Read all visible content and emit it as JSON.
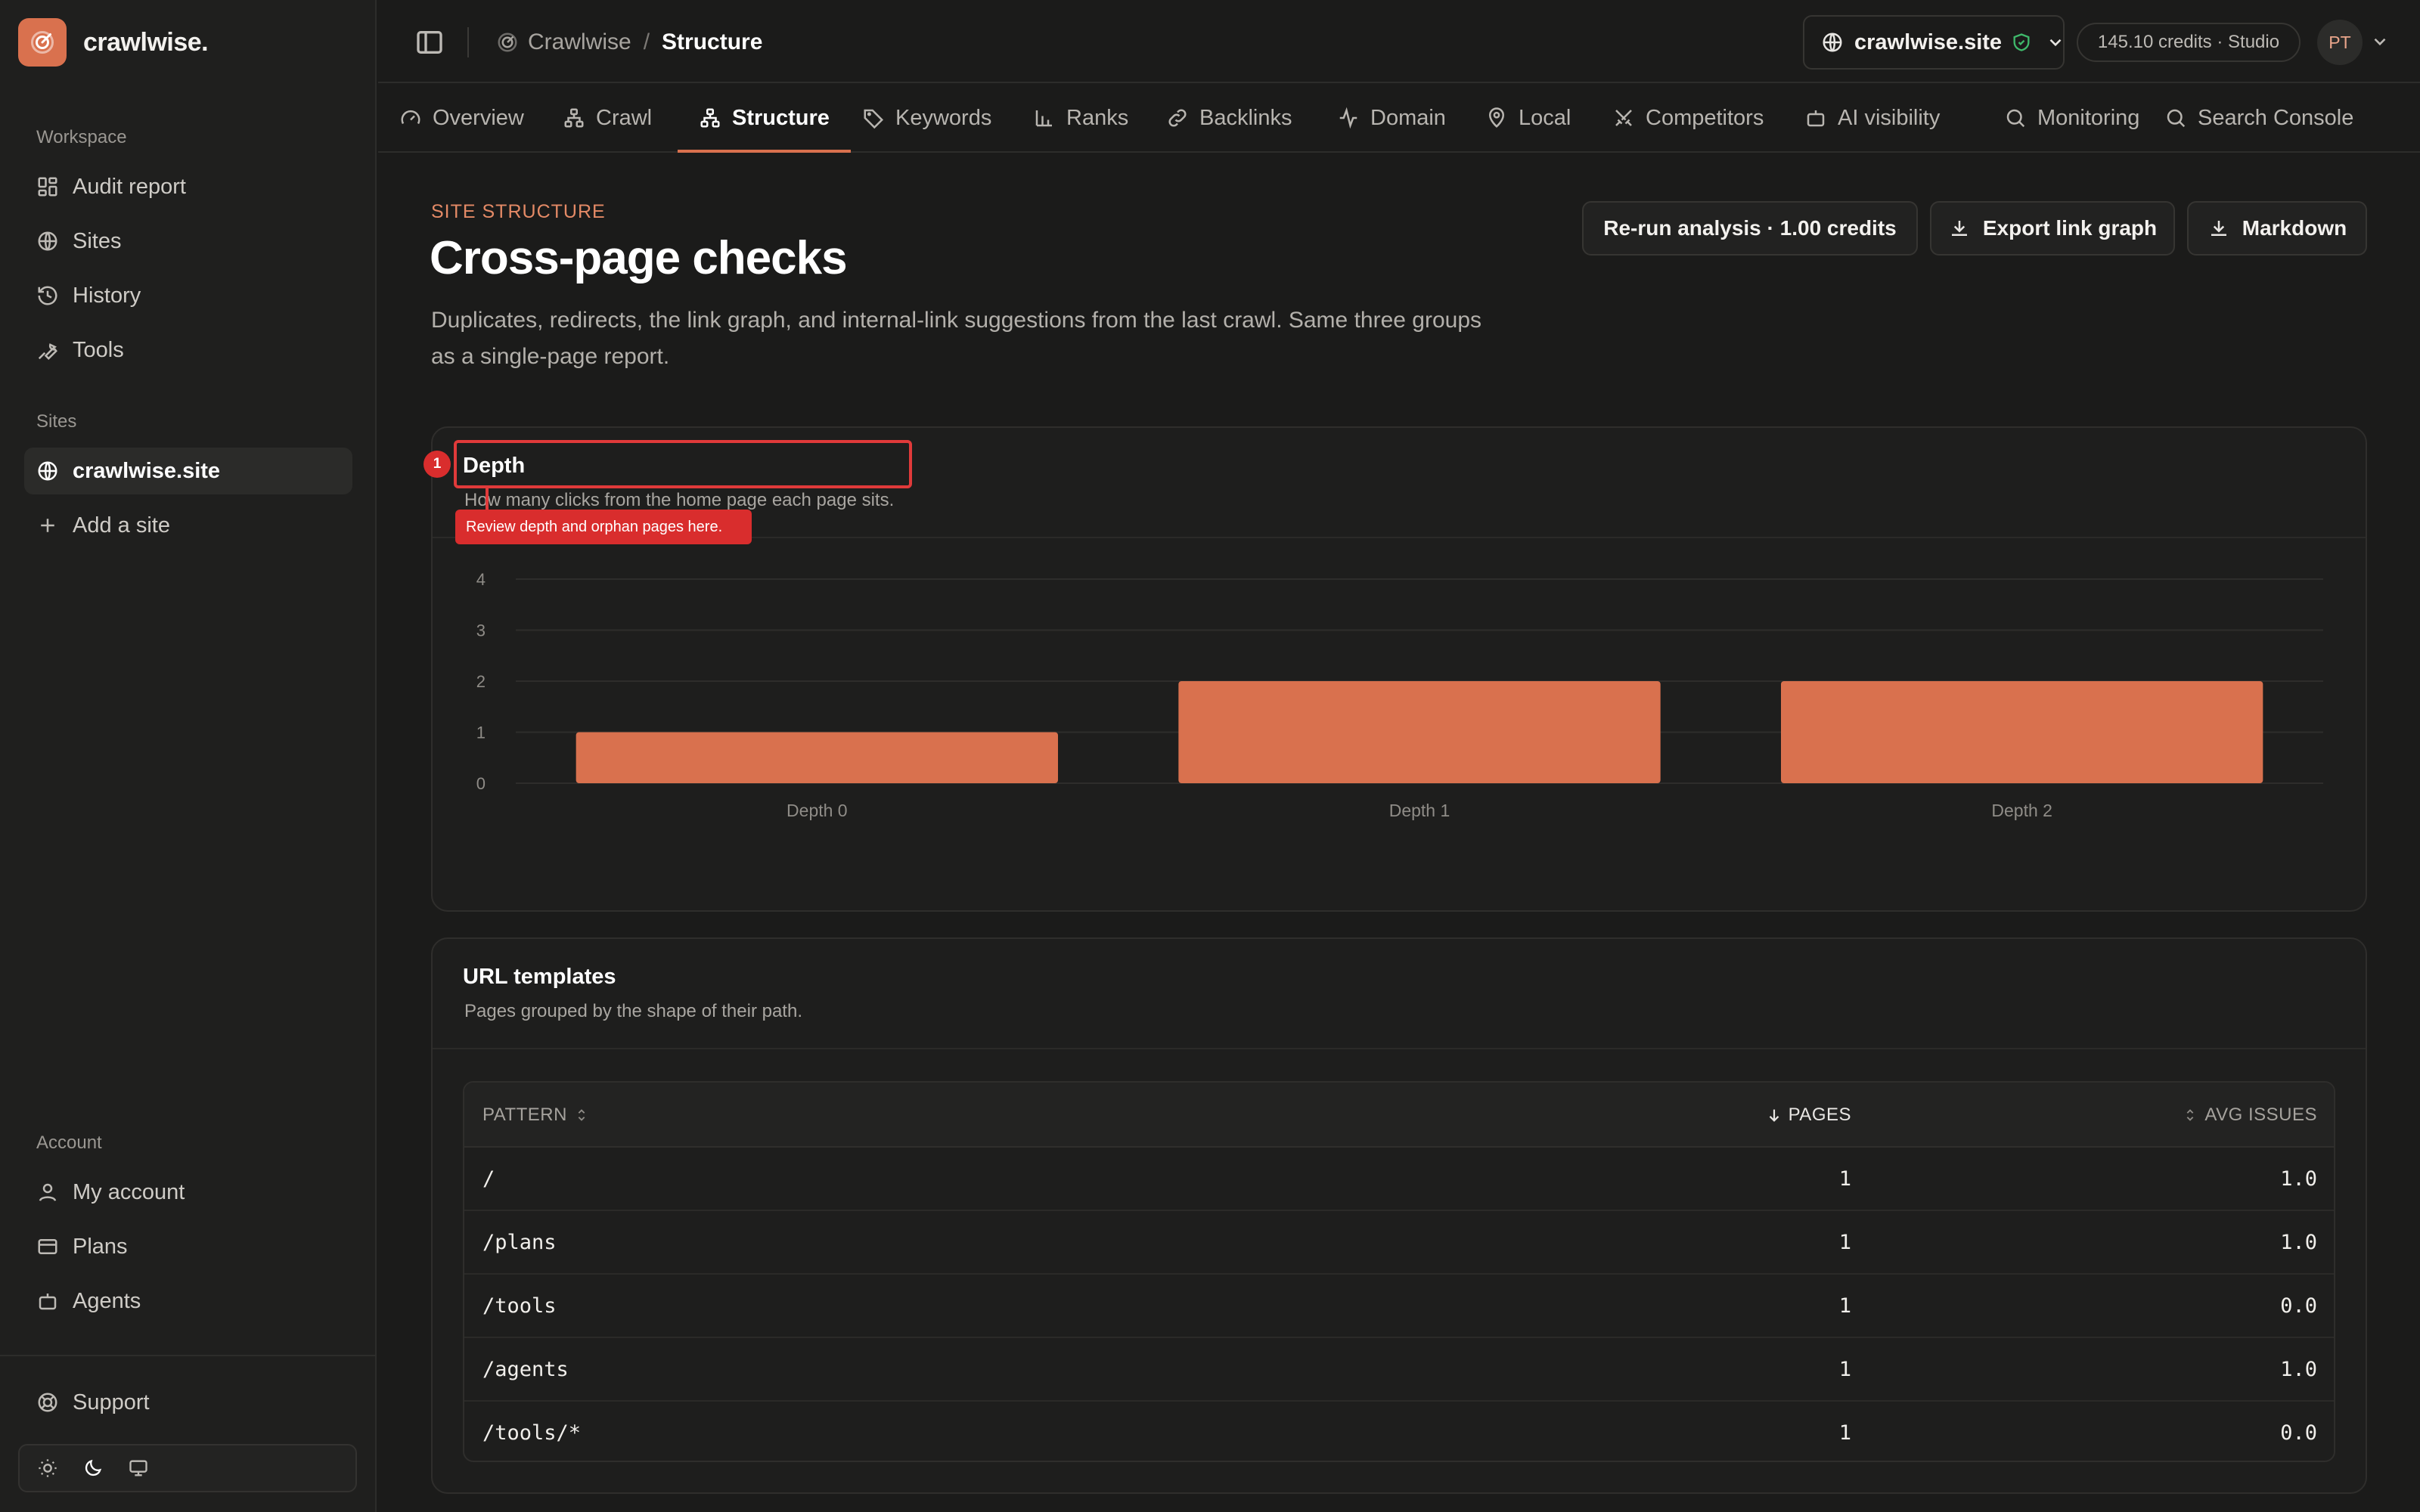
{
  "app": {
    "name": "crawlwise."
  },
  "sidebar": {
    "workspace_label": "Workspace",
    "workspace_items": [
      {
        "label": "Audit report",
        "icon": "dashboard-icon"
      },
      {
        "label": "Sites",
        "icon": "globe-icon"
      },
      {
        "label": "History",
        "icon": "history-icon"
      },
      {
        "label": "Tools",
        "icon": "wrench-icon"
      }
    ],
    "sites_label": "Sites",
    "site_items": [
      {
        "label": "crawlwise.site",
        "icon": "globe-icon",
        "active": true
      },
      {
        "label": "Add a site",
        "icon": "plus-icon"
      }
    ],
    "account_label": "Account",
    "account_items": [
      {
        "label": "My account",
        "icon": "user-icon"
      },
      {
        "label": "Plans",
        "icon": "card-icon"
      },
      {
        "label": "Agents",
        "icon": "bot-icon"
      }
    ],
    "support_label": "Support",
    "theme_options": [
      "sun-icon",
      "moon-icon",
      "monitor-icon"
    ]
  },
  "topbar": {
    "breadcrumb_root": "Crawlwise",
    "breadcrumb_separator": "/",
    "breadcrumb_current": "Structure",
    "site_selector": "crawlwise.site",
    "credits": "145.10 credits · Studio",
    "avatar_initials": "PT"
  },
  "tabs": [
    {
      "label": "Overview",
      "icon": "gauge-icon"
    },
    {
      "label": "Crawl",
      "icon": "sitemap-icon"
    },
    {
      "label": "Structure",
      "icon": "sitemap-icon",
      "active": true
    },
    {
      "label": "Keywords",
      "icon": "tag-icon"
    },
    {
      "label": "Ranks",
      "icon": "bar-chart-icon"
    },
    {
      "label": "Backlinks",
      "icon": "link-icon"
    },
    {
      "label": "Domain",
      "icon": "activity-icon"
    },
    {
      "label": "Local",
      "icon": "pin-icon"
    },
    {
      "label": "Competitors",
      "icon": "swords-icon"
    },
    {
      "label": "AI visibility",
      "icon": "bot-icon"
    },
    {
      "label": "Monitoring",
      "icon": "search-icon"
    },
    {
      "label": "Search Console",
      "icon": "search-icon"
    }
  ],
  "page": {
    "eyebrow": "SITE STRUCTURE",
    "title": "Cross-page checks",
    "description": "Duplicates, redirects, the link graph, and internal-link suggestions from the last crawl. Same three groups as a single-page report.",
    "actions": {
      "rerun": "Re-run analysis · 1.00 credits",
      "export": "Export link graph",
      "markdown": "Markdown"
    }
  },
  "depth_card": {
    "title": "Depth",
    "subtitle": "How many clicks from the home page each page sits.",
    "annotation_number": "1",
    "annotation_text": "Review depth and orphan pages here."
  },
  "chart_data": {
    "type": "bar",
    "categories": [
      "Depth 0",
      "Depth 1",
      "Depth 2"
    ],
    "values": [
      1,
      2,
      2
    ],
    "ylim": [
      0,
      4
    ],
    "yticks": [
      0,
      1,
      2,
      3,
      4
    ],
    "grid": true,
    "bar_color": "#d9714e"
  },
  "templates_card": {
    "title": "URL templates",
    "subtitle": "Pages grouped by the shape of their path.",
    "columns": [
      "PATTERN",
      "PAGES",
      "AVG ISSUES"
    ],
    "rows": [
      {
        "pattern": "/",
        "pages": "1",
        "avg": "1.0"
      },
      {
        "pattern": "/plans",
        "pages": "1",
        "avg": "1.0"
      },
      {
        "pattern": "/tools",
        "pages": "1",
        "avg": "0.0"
      },
      {
        "pattern": "/agents",
        "pages": "1",
        "avg": "1.0"
      },
      {
        "pattern": "/tools/*",
        "pages": "1",
        "avg": "0.0"
      }
    ]
  },
  "colors": {
    "accent": "#d9714e",
    "annotation": "#d92d2d",
    "background": "#1b1b1a"
  }
}
